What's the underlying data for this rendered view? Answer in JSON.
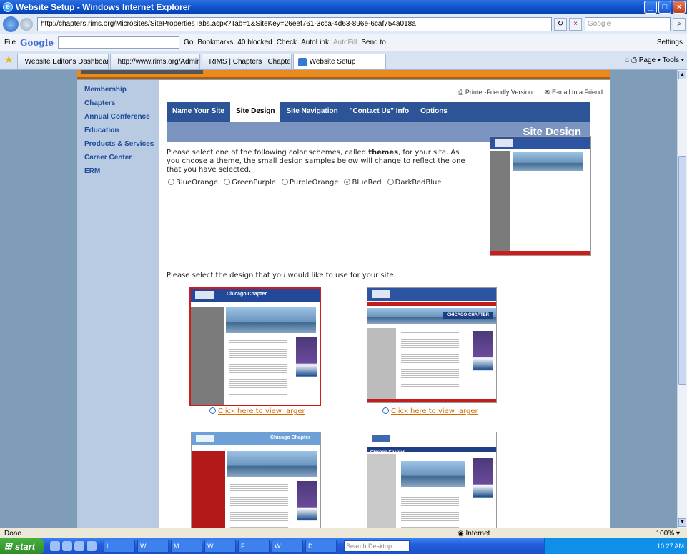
{
  "window": {
    "title": "Website Setup - Windows Internet Explorer"
  },
  "address": {
    "url": "http://chapters.rims.org/Microsites/SitePropertiesTabs.aspx?Tab=1&SiteKey=26eef761-3cca-4d63-896e-6caf754a018a",
    "search_placeholder": "Google"
  },
  "toolbar": {
    "file": "File",
    "google": "Google",
    "go": "Go",
    "bookmarks": "Bookmarks",
    "blocked": "40 blocked",
    "check": "Check",
    "autolink": "AutoLink",
    "autofill": "AutoFill",
    "sendto": "Send to",
    "settings": "Settings"
  },
  "tabs": [
    {
      "label": "Website Editor's Dashboard",
      "active": false
    },
    {
      "label": "http://www.rims.org/AdminT...",
      "active": false
    },
    {
      "label": "RIMS | Chapters | Chapter ...",
      "active": false
    },
    {
      "label": "Website Setup",
      "active": true
    }
  ],
  "tab_tools": {
    "page": "Page",
    "tools": "Tools"
  },
  "sidebar": {
    "items": [
      {
        "label": "Membership"
      },
      {
        "label": "Chapters"
      },
      {
        "label": "Annual Conference"
      },
      {
        "label": "Education"
      },
      {
        "label": "Products & Services"
      },
      {
        "label": "Career Center"
      },
      {
        "label": "ERM"
      }
    ]
  },
  "top_links": {
    "printer": "Printer-Friendly Version",
    "email": "E-mail to a Friend"
  },
  "site_tabs": [
    {
      "label": "Name Your Site",
      "active": false
    },
    {
      "label": "Site Design",
      "active": true
    },
    {
      "label": "Site Navigation",
      "active": false
    },
    {
      "label": "\"Contact Us\" Info",
      "active": false
    },
    {
      "label": "Options",
      "active": false
    }
  ],
  "section_heading": "Site Design",
  "intro": {
    "before": "Please select one of the following color schemes, called ",
    "bold": "themes",
    "after": ", for your site. As you choose a theme, the small design samples below will change to reflect the one that you have selected."
  },
  "themes": [
    {
      "label": "BlueOrange",
      "selected": false
    },
    {
      "label": "GreenPurple",
      "selected": false
    },
    {
      "label": "PurpleOrange",
      "selected": false
    },
    {
      "label": "BlueRed",
      "selected": true
    },
    {
      "label": "DarkRedBlue",
      "selected": false
    }
  ],
  "design_prompt": "Please select the design that you would like to use for your site:",
  "designs": [
    {
      "title": "Chicago Chapter",
      "link": "Click here to view larger",
      "selected": true
    },
    {
      "title": "CHICAGO CHAPTER",
      "link": "Click here to view larger",
      "selected": false
    },
    {
      "title": "Chicago Chapter",
      "link": "",
      "selected": false
    },
    {
      "title": "Chicago Chapter",
      "link": "",
      "selected": false
    }
  ],
  "status": {
    "text": "Done",
    "zone": "Internet",
    "zoom": "100%"
  },
  "taskbar": {
    "start": "start",
    "search_placeholder": "Search Desktop",
    "clock": "10:27 AM"
  }
}
